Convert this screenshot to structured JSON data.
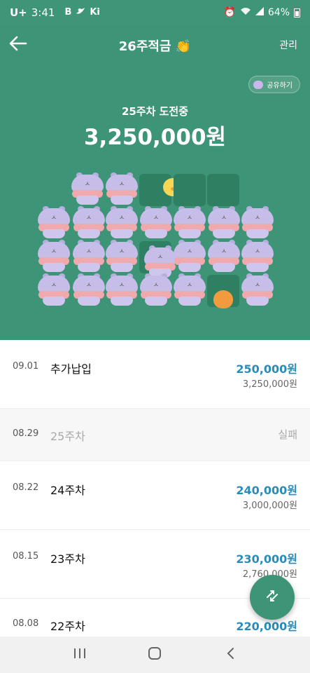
{
  "status": {
    "carrier": "U+",
    "time": "3:41",
    "notif_icons": [
      "B",
      "bird-icon",
      "Ki"
    ],
    "battery": "64%"
  },
  "header": {
    "title": "26주적금 👏",
    "manage_label": "관리",
    "share_label": "공유하기",
    "challenge_label": "25주차 도전중",
    "amount": "3,250,000원"
  },
  "colors": {
    "brand_green": "#3d9476",
    "amount_blue": "#2a8cb8"
  },
  "list": [
    {
      "date": "09.01",
      "label": "추가납입",
      "amount": "250,000원",
      "total": "3,250,000원",
      "status": "paid"
    },
    {
      "date": "08.29",
      "label": "25주차",
      "status": "failed",
      "status_text": "실패"
    },
    {
      "date": "08.22",
      "label": "24주차",
      "amount": "240,000원",
      "total": "3,000,000원",
      "status": "paid"
    },
    {
      "date": "08.15",
      "label": "23주차",
      "amount": "230,000원",
      "total": "2,760,000원",
      "status": "paid"
    },
    {
      "date": "08.08",
      "label": "22주차",
      "amount": "220,000원",
      "status": "paid"
    }
  ],
  "icons": {
    "back": "arrow-left-icon",
    "fab": "swap-arrows-icon",
    "nav_recent": "recent-apps-icon",
    "nav_home": "home-icon",
    "nav_back": "back-chevron-icon"
  }
}
